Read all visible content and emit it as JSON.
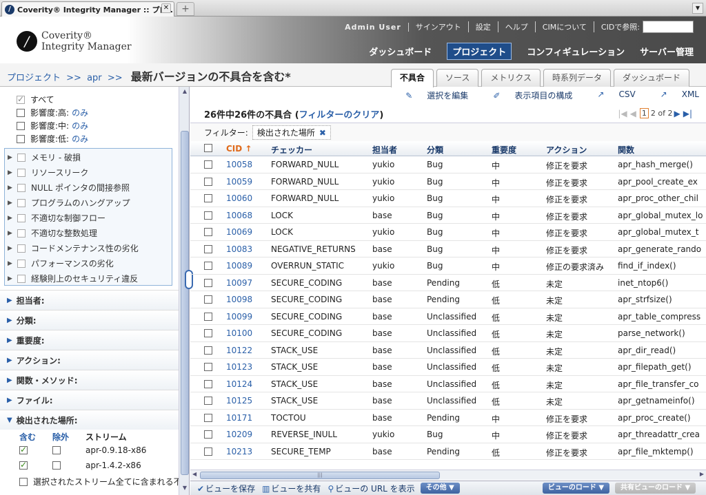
{
  "browser": {
    "tab_title": "Coverity® Integrity Manager :: プロ...",
    "new_tab": "+"
  },
  "brand": {
    "line1": "Coverity®",
    "line2": "Integrity Manager"
  },
  "toplinks": {
    "user": "Admin User",
    "signout": "サインアウト",
    "settings": "設定",
    "help": "ヘルプ",
    "about": "CIMについて",
    "cid_lookup": "CIDで参照:"
  },
  "mainnav": {
    "dashboard": "ダッシュボード",
    "project": "プロジェクト",
    "configuration": "コンフィギュレーション",
    "server_admin": "サーバー管理"
  },
  "breadcrumb": {
    "project": "プロジェクト",
    "sep": ">>",
    "apr": "apr",
    "title": "最新バージョンの不具合を含む*"
  },
  "viewtabs": [
    "不具合",
    "ソース",
    "メトリクス",
    "時系列データ",
    "ダッシュボード"
  ],
  "sidebar": {
    "impact": [
      {
        "label": "すべて",
        "only": "",
        "checked": true
      },
      {
        "label": "影響度:高:",
        "only": "のみ",
        "checked": false
      },
      {
        "label": "影響度:中:",
        "only": "のみ",
        "checked": false
      },
      {
        "label": "影響度:低:",
        "only": "のみ",
        "checked": false
      }
    ],
    "categories": [
      "メモリ - 破損",
      "リソースリーク",
      "NULL ポインタの間接参照",
      "プログラムのハングアップ",
      "不適切な制御フロー",
      "不適切な整数処理",
      "コードメンテナンス性の劣化",
      "パフォーマンスの劣化",
      "経験則上のセキュリティ違反"
    ],
    "sections": [
      "担当者:",
      "分類:",
      "重要度:",
      "アクション:",
      "関数・メソッド:",
      "ファイル:"
    ],
    "detected": {
      "title": "検出された場所:",
      "col_include": "含む",
      "col_exclude": "除外",
      "col_stream": "ストリーム",
      "streams": [
        {
          "name": "apr-0.9.18-x86"
        },
        {
          "name": "apr-1.4.2-x86"
        }
      ],
      "all_streams": "選択されたストリーム全てに含まれる不具..."
    }
  },
  "actions": {
    "edit_selection": "選択を編集",
    "columns": "表示項目の構成",
    "csv": "CSV",
    "xml": "XML"
  },
  "summary": {
    "count_text": "26件中26件の不具合 (",
    "clear_filter": "フィルターのクリア",
    "close": ")"
  },
  "pager": {
    "current": "1",
    "of_text": "2 of 2"
  },
  "filter": {
    "label": "フィルター:",
    "chip": "検出された場所"
  },
  "table": {
    "headers": {
      "cid": "CID",
      "checker": "チェッカー",
      "owner": "担当者",
      "classification": "分類",
      "severity": "重要度",
      "action": "アクション",
      "function": "関数"
    },
    "rows": [
      [
        "10058",
        "FORWARD_NULL",
        "yukio",
        "Bug",
        "中",
        "修正を要求",
        "apr_hash_merge()"
      ],
      [
        "10059",
        "FORWARD_NULL",
        "yukio",
        "Bug",
        "中",
        "修正を要求",
        "apr_pool_create_ex"
      ],
      [
        "10060",
        "FORWARD_NULL",
        "yukio",
        "Bug",
        "中",
        "修正を要求",
        "apr_proc_other_chil"
      ],
      [
        "10068",
        "LOCK",
        "base",
        "Bug",
        "中",
        "修正を要求",
        "apr_global_mutex_lo"
      ],
      [
        "10069",
        "LOCK",
        "yukio",
        "Bug",
        "中",
        "修正を要求",
        "apr_global_mutex_t"
      ],
      [
        "10083",
        "NEGATIVE_RETURNS",
        "base",
        "Bug",
        "中",
        "修正を要求",
        "apr_generate_rando"
      ],
      [
        "10089",
        "OVERRUN_STATIC",
        "yukio",
        "Bug",
        "中",
        "修正の要求済み",
        "find_if_index()"
      ],
      [
        "10097",
        "SECURE_CODING",
        "base",
        "Pending",
        "低",
        "未定",
        "inet_ntop6()"
      ],
      [
        "10098",
        "SECURE_CODING",
        "base",
        "Pending",
        "低",
        "未定",
        "apr_strfsize()"
      ],
      [
        "10099",
        "SECURE_CODING",
        "base",
        "Unclassified",
        "低",
        "未定",
        "apr_table_compress"
      ],
      [
        "10100",
        "SECURE_CODING",
        "base",
        "Unclassified",
        "低",
        "未定",
        "parse_network()"
      ],
      [
        "10122",
        "STACK_USE",
        "base",
        "Unclassified",
        "低",
        "未定",
        "apr_dir_read()"
      ],
      [
        "10123",
        "STACK_USE",
        "base",
        "Unclassified",
        "低",
        "未定",
        "apr_filepath_get()"
      ],
      [
        "10124",
        "STACK_USE",
        "base",
        "Unclassified",
        "低",
        "未定",
        "apr_file_transfer_co"
      ],
      [
        "10125",
        "STACK_USE",
        "base",
        "Unclassified",
        "低",
        "未定",
        "apr_getnameinfo()"
      ],
      [
        "10171",
        "TOCTOU",
        "base",
        "Pending",
        "中",
        "修正を要求",
        "apr_proc_create()"
      ],
      [
        "10209",
        "REVERSE_INULL",
        "yukio",
        "Bug",
        "中",
        "修正を要求",
        "apr_threadattr_crea"
      ],
      [
        "10213",
        "SECURE_TEMP",
        "base",
        "Pending",
        "低",
        "修正を要求",
        "apr_file_mktemp()"
      ]
    ]
  },
  "bottombar": {
    "save_view": "ビューを保存",
    "share_view": "ビューを共有",
    "view_url": "ビューの URL を表示",
    "other": "その他",
    "load_view": "ビューのロード",
    "load_shared": "共有ビューのロード"
  }
}
